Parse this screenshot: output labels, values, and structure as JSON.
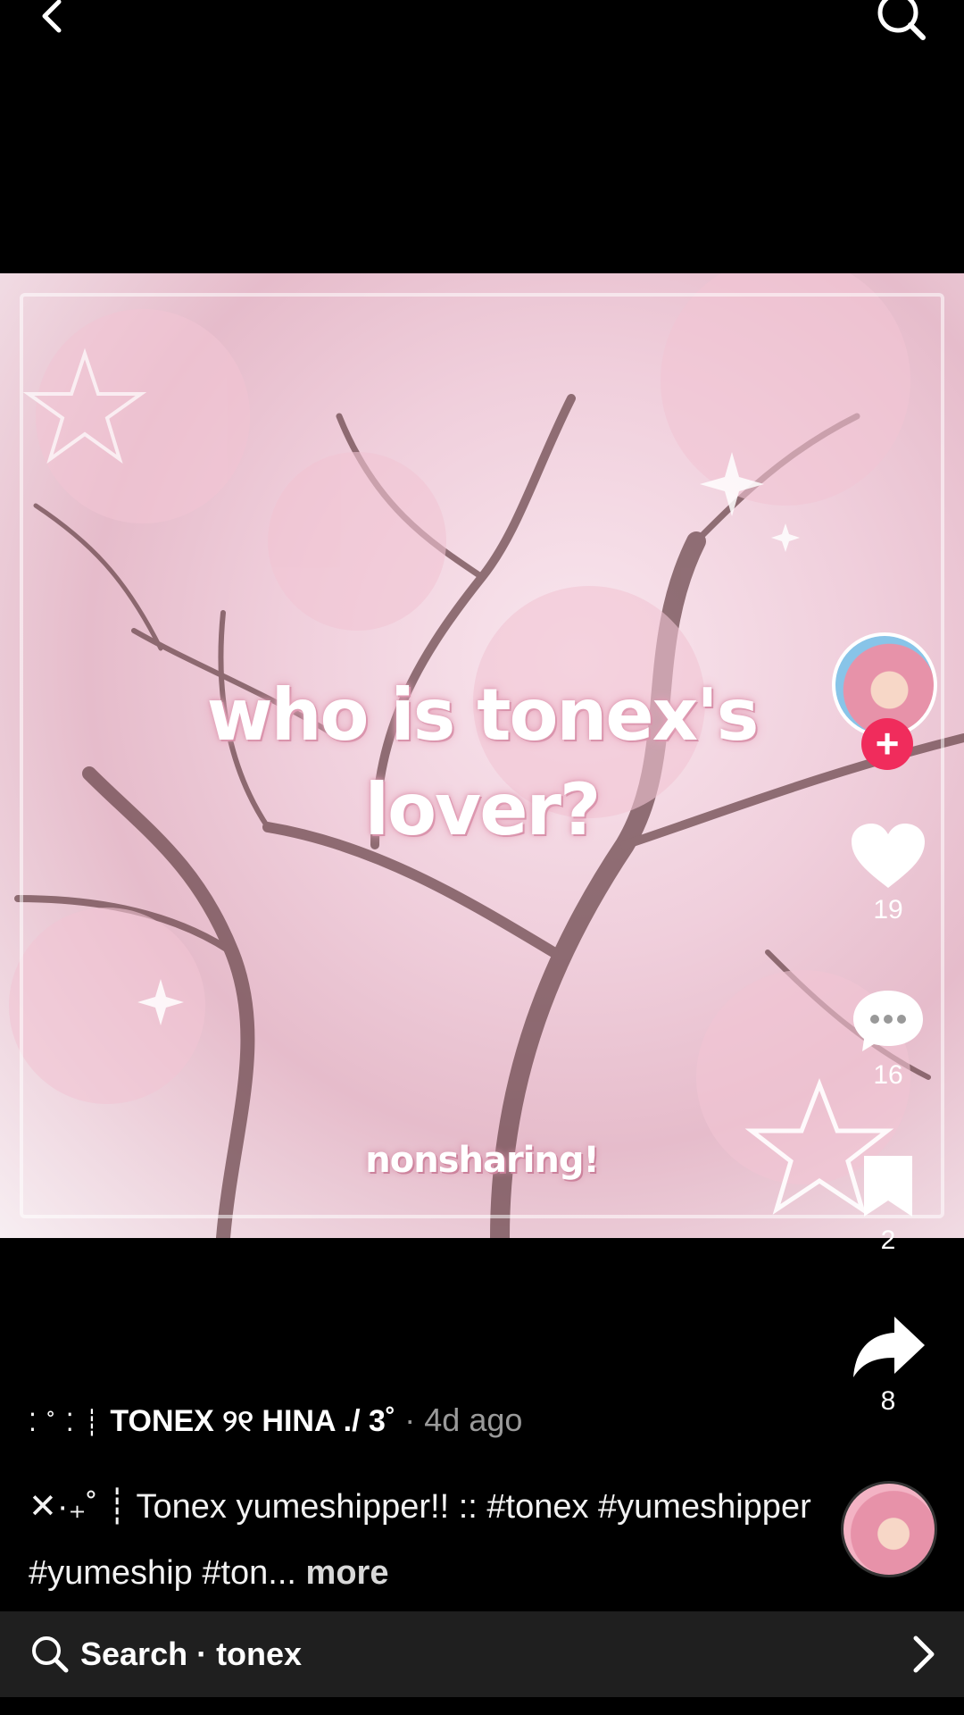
{
  "video": {
    "title_line1": "who is tonex's",
    "title_line2": "lover?",
    "subtitle": "nonsharing!"
  },
  "actions": {
    "likes": "19",
    "comments": "16",
    "favorites": "2",
    "shares": "8"
  },
  "caption": {
    "author_prefix": "⁚ ˚ ⁚ ┊",
    "author_name": "TONEX ୨୧ HINA ./ 3˚",
    "time": "· 4d ago",
    "desc_prefix": "✕·₊˚ ┊",
    "desc_text": "Tonex yumeshipper!! :: #tonex #yumeshipper #yumeship #ton...",
    "more": "more"
  },
  "search": {
    "label": "Search · tonex"
  },
  "colors": {
    "follow": "#f02c5c",
    "searchbar_bg": "#1f1f1f"
  }
}
